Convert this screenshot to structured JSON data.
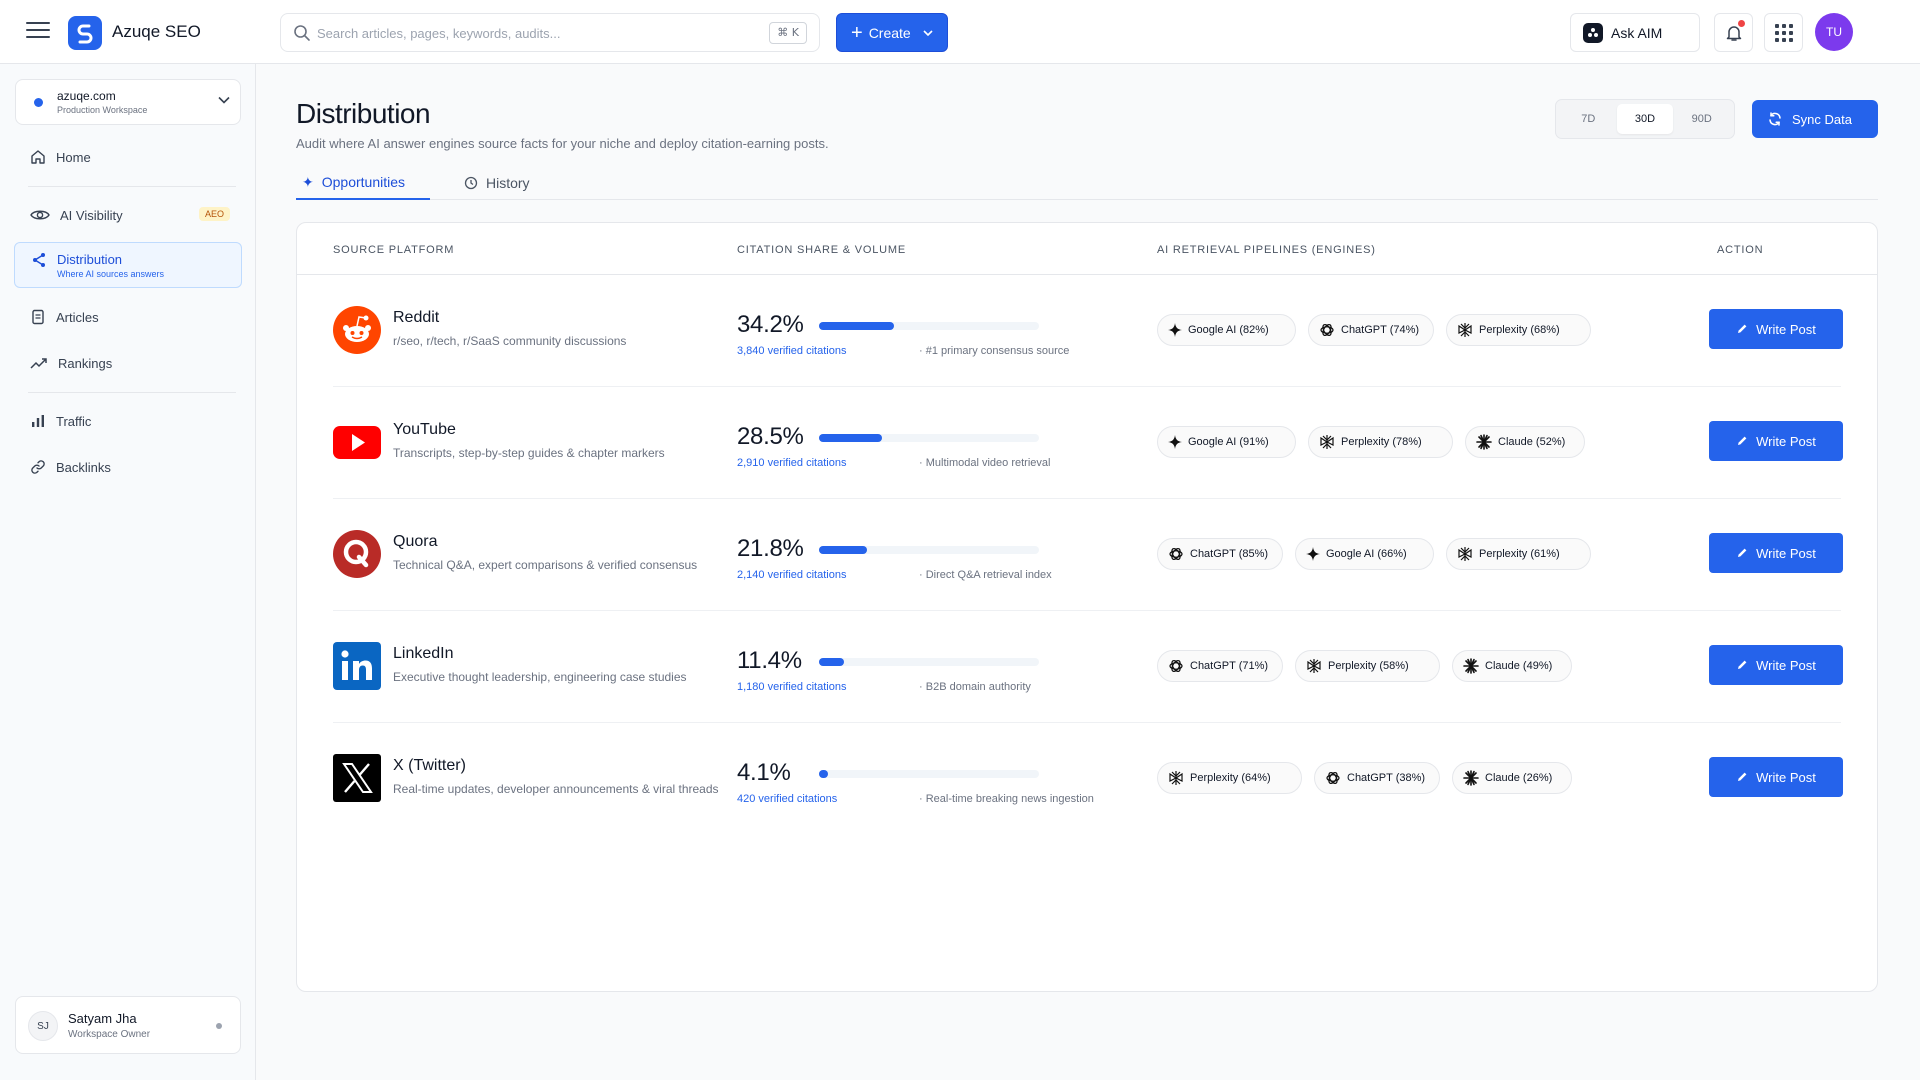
{
  "app": {
    "name": "Azuqe SEO"
  },
  "search": {
    "placeholder": "Search articles, pages, keywords, audits...",
    "shortcut": "⌘ K"
  },
  "header": {
    "create_label": "Create",
    "ask_label": "Ask AIM",
    "avatar_initials": "TU"
  },
  "workspace": {
    "name": "azuqe.com",
    "subtitle": "Production Workspace"
  },
  "sidebar": {
    "items": [
      {
        "label": "Home",
        "icon": "home-icon"
      },
      {
        "label": "AI Visibility",
        "icon": "eye-icon",
        "badge": "AEO"
      },
      {
        "label": "Distribution",
        "icon": "share-icon",
        "subtitle": "Where AI sources answers",
        "active": true
      },
      {
        "label": "Articles",
        "icon": "document-icon"
      },
      {
        "label": "Rankings",
        "icon": "trending-up-icon"
      },
      {
        "label": "Traffic",
        "icon": "bar-chart-icon"
      },
      {
        "label": "Backlinks",
        "icon": "link-icon"
      }
    ]
  },
  "user": {
    "initials": "SJ",
    "name": "Satyam Jha",
    "role": "Workspace Owner"
  },
  "page": {
    "title": "Distribution",
    "subtitle": "Audit where AI answer engines source facts for your niche and deploy citation-earning posts.",
    "ranges": [
      "7D",
      "30D",
      "90D"
    ],
    "active_range": "30D",
    "sync_label": "Sync Data",
    "tabs": [
      {
        "label": "Opportunities",
        "active": true
      },
      {
        "label": "History"
      }
    ]
  },
  "table": {
    "headers": [
      "SOURCE PLATFORM",
      "CITATION SHARE & VOLUME",
      "AI RETRIEVAL PIPELINES (ENGINES)",
      "ACTION"
    ],
    "action_label": "Write Post",
    "rows": [
      {
        "name": "Reddit",
        "logo": "reddit-logo",
        "desc": "r/seo, r/tech, r/SaaS community discussions",
        "share": "34.2%",
        "share_value": 34.2,
        "citations": "3,840 verified citations",
        "note": "#1 primary consensus source",
        "engines": [
          "Google AI (82%)",
          "ChatGPT (74%)",
          "Perplexity (68%)"
        ],
        "engine_icons": [
          "google-ai-icon",
          "chatgpt-icon",
          "perplexity-icon"
        ]
      },
      {
        "name": "YouTube",
        "logo": "youtube-logo",
        "desc": "Transcripts, step-by-step guides & chapter markers",
        "share": "28.5%",
        "share_value": 28.5,
        "citations": "2,910 verified citations",
        "note": "Multimodal video retrieval",
        "engines": [
          "Google AI (91%)",
          "Perplexity (78%)",
          "Claude (52%)"
        ],
        "engine_icons": [
          "google-ai-icon",
          "perplexity-icon",
          "claude-icon"
        ]
      },
      {
        "name": "Quora",
        "logo": "quora-logo",
        "desc": "Technical Q&A, expert comparisons & verified consensus",
        "share": "21.8%",
        "share_value": 21.8,
        "citations": "2,140 verified citations",
        "note": "Direct Q&A retrieval index",
        "engines": [
          "ChatGPT (85%)",
          "Google AI (66%)",
          "Perplexity (61%)"
        ],
        "engine_icons": [
          "chatgpt-icon",
          "google-ai-icon",
          "perplexity-icon"
        ]
      },
      {
        "name": "LinkedIn",
        "logo": "linkedin-logo",
        "desc": "Executive thought leadership, engineering case studies",
        "share": "11.4%",
        "share_value": 11.4,
        "citations": "1,180 verified citations",
        "note": "B2B domain authority",
        "engines": [
          "ChatGPT (71%)",
          "Perplexity (58%)",
          "Claude (49%)"
        ],
        "engine_icons": [
          "chatgpt-icon",
          "perplexity-icon",
          "claude-icon"
        ]
      },
      {
        "name": "X (Twitter)",
        "logo": "x-logo",
        "desc": "Real-time updates, developer announcements & viral threads",
        "share": "4.1%",
        "share_value": 4.1,
        "citations": "420 verified citations",
        "note": "Real-time breaking news ingestion",
        "engines": [
          "Perplexity (64%)",
          "ChatGPT (38%)",
          "Claude (26%)"
        ],
        "engine_icons": [
          "perplexity-icon",
          "chatgpt-icon",
          "claude-icon"
        ]
      }
    ]
  },
  "colors": {
    "accent": "#2563eb",
    "reddit": "#ff4500",
    "youtube": "#ff0000",
    "quora": "#b92b27",
    "linkedin": "#0a66c2",
    "x": "#000000"
  }
}
